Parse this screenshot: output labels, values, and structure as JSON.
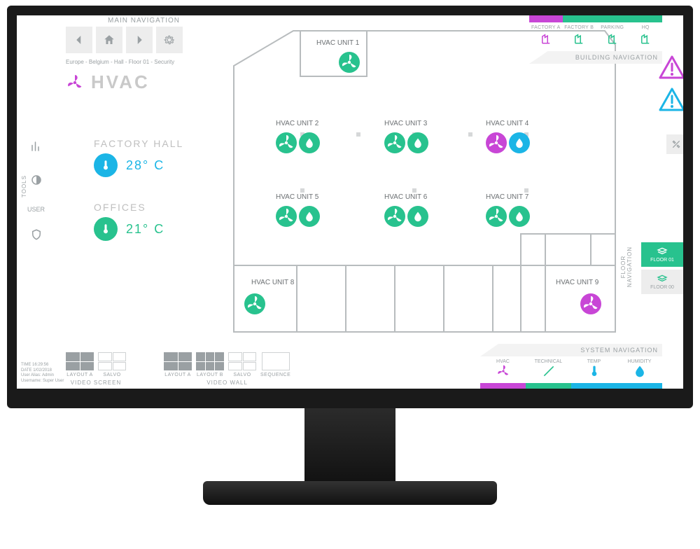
{
  "main_nav": {
    "title": "MAIN NAVIGATION"
  },
  "breadcrumb": "Europe - Belgium - Hall - Floor 01 - Security",
  "page": {
    "title": "HVAC"
  },
  "tools_label": "TOOLS",
  "user_label": "USER",
  "temperatures": {
    "hall": {
      "label": "FACTORY HALL",
      "value": "28° C"
    },
    "offices": {
      "label": "OFFICES",
      "value": "21° C"
    }
  },
  "hvac_units": {
    "u1": "HVAC UNIT 1",
    "u2": "HVAC UNIT 2",
    "u3": "HVAC UNIT 3",
    "u4": "HVAC UNIT 4",
    "u5": "HVAC UNIT 5",
    "u6": "HVAC UNIT 6",
    "u7": "HVAC UNIT 7",
    "u8": "HVAC UNIT 8",
    "u9": "HVAC UNIT 9"
  },
  "building_nav": {
    "title": "BUILDING NAVIGATION",
    "items": [
      "FACTORY A",
      "FACTORY B",
      "PARKING",
      "HQ"
    ],
    "colors": [
      "#c846d6",
      "#28c28e",
      "#28c28e",
      "#28c28e"
    ]
  },
  "floor_nav": {
    "title": "FLOOR NAVIGATION",
    "items": [
      "FLOOR 01",
      "FLOOR 00"
    ]
  },
  "system_nav": {
    "title": "SYSTEM NAVIGATION",
    "items": [
      "HVAC",
      "TECHNICAL",
      "TEMP",
      "HUMIDITY"
    ],
    "colors": [
      "#c846d6",
      "#28c28e",
      "#1bb5e6",
      "#1bb5e6"
    ]
  },
  "video_screen": {
    "title": "VIDEO SCREEN",
    "items": [
      "LAYOUT A",
      "SALVO"
    ]
  },
  "video_wall": {
    "title": "VIDEO WALL",
    "items": [
      "LAYOUT A",
      "LAYOUT B",
      "SALVO",
      "SEQUENCE"
    ]
  },
  "status": {
    "time": "TIME 16:29:56",
    "date": "DATE 1/02/2018",
    "alias": "User Alias: Admin",
    "user": "Username: Super User"
  }
}
